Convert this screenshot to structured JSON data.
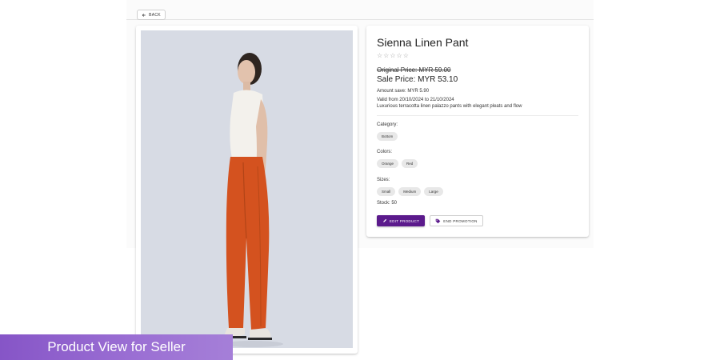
{
  "nav": {
    "back_label": "BACK"
  },
  "product": {
    "name": "Sienna Linen Pant",
    "rating_stars": 0,
    "rating_max": 5,
    "original_price": "Original Price: MYR 59.00",
    "sale_price": "Sale Price: MYR 53.10",
    "amount_save": "Amount save: MYR 5.90",
    "valid_range": "Valid from 20/10/2024 to 21/10/2024",
    "description": "Luxurious terracotta linen palazzo pants with elegant pleats and flow",
    "category_label": "Category:",
    "category": "Bottom",
    "colors_label": "Colors:",
    "colors": [
      "Orange",
      "Red"
    ],
    "sizes_label": "Sizes:",
    "sizes": [
      "Small",
      "Medium",
      "Large"
    ],
    "stock": "Stock: 50"
  },
  "actions": {
    "edit_label": "EDIT PRODUCT",
    "promo_label": "END PROMOTION"
  },
  "banner": {
    "text": "Product View for Seller"
  },
  "colors": {
    "primary": "#5b1a8c",
    "banner": "#9466d0",
    "pants": "#d4521f"
  },
  "icons": {
    "back": "arrow-left-icon",
    "edit": "pencil-icon",
    "promo": "tag-icon",
    "star": "star-outline-icon"
  }
}
